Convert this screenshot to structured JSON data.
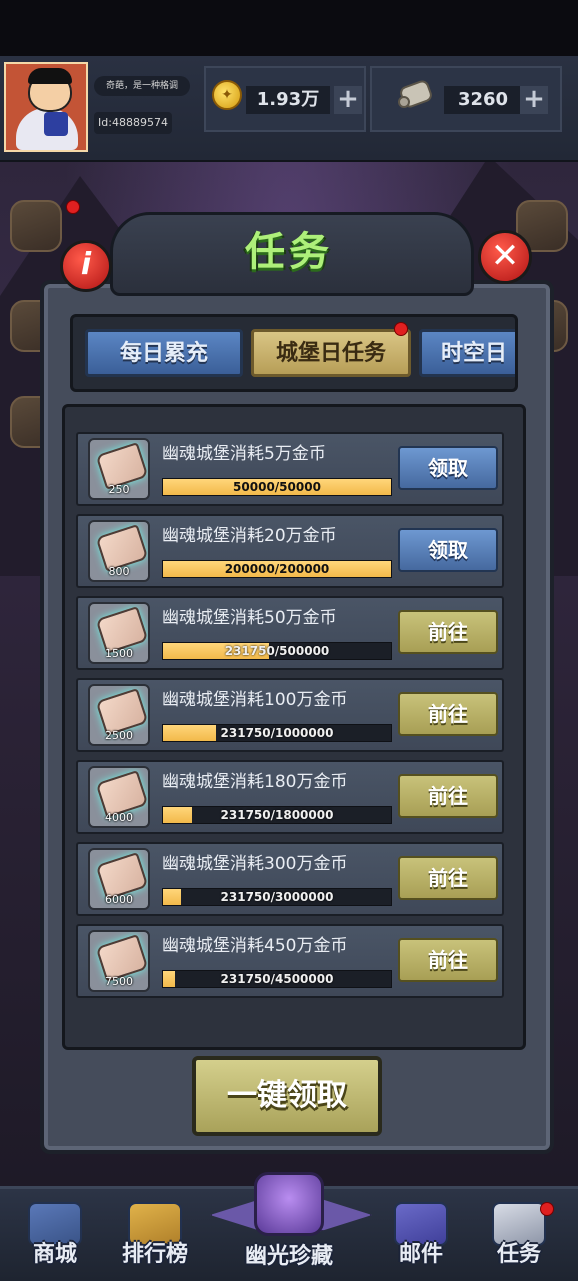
{
  "header": {
    "motto": "奇葩，是一种格调",
    "player_id": "Id:48889574",
    "coins": "1.93万",
    "scrolls": "3260",
    "plus": "+"
  },
  "panel": {
    "title": "任务",
    "info_label": "i",
    "close_label": "✕"
  },
  "tabs": [
    {
      "label": "每日累充",
      "active": false
    },
    {
      "label": "城堡日任务",
      "active": true
    },
    {
      "label": "时空日",
      "active": false
    }
  ],
  "tasks": [
    {
      "name": "幽魂城堡消耗5万金币",
      "reward": "250",
      "current": 50000,
      "target": 50000,
      "progress_text": "50000/50000",
      "action": "领取"
    },
    {
      "name": "幽魂城堡消耗20万金币",
      "reward": "800",
      "current": 200000,
      "target": 200000,
      "progress_text": "200000/200000",
      "action": "领取"
    },
    {
      "name": "幽魂城堡消耗50万金币",
      "reward": "1500",
      "current": 231750,
      "target": 500000,
      "progress_text": "231750/500000",
      "action": "前往"
    },
    {
      "name": "幽魂城堡消耗100万金币",
      "reward": "2500",
      "current": 231750,
      "target": 1000000,
      "progress_text": "231750/1000000",
      "action": "前往"
    },
    {
      "name": "幽魂城堡消耗180万金币",
      "reward": "4000",
      "current": 231750,
      "target": 1800000,
      "progress_text": "231750/1800000",
      "action": "前往"
    },
    {
      "name": "幽魂城堡消耗300万金币",
      "reward": "6000",
      "current": 231750,
      "target": 3000000,
      "progress_text": "231750/3000000",
      "action": "前往"
    },
    {
      "name": "幽魂城堡消耗450万金币",
      "reward": "7500",
      "current": 231750,
      "target": 4500000,
      "progress_text": "231750/4500000",
      "action": "前往"
    }
  ],
  "claim_all": "一键领取",
  "nav": {
    "shop": "商城",
    "ranking": "排行榜",
    "treasure": "幽光珍藏",
    "mail": "邮件",
    "quests": "任务"
  },
  "colors": {
    "claim_button": "#5a84c0",
    "go_button": "#b9b168",
    "progress_fill": "#f6c55c",
    "title_green": "#aef07a",
    "red_badge": "#e02020"
  }
}
